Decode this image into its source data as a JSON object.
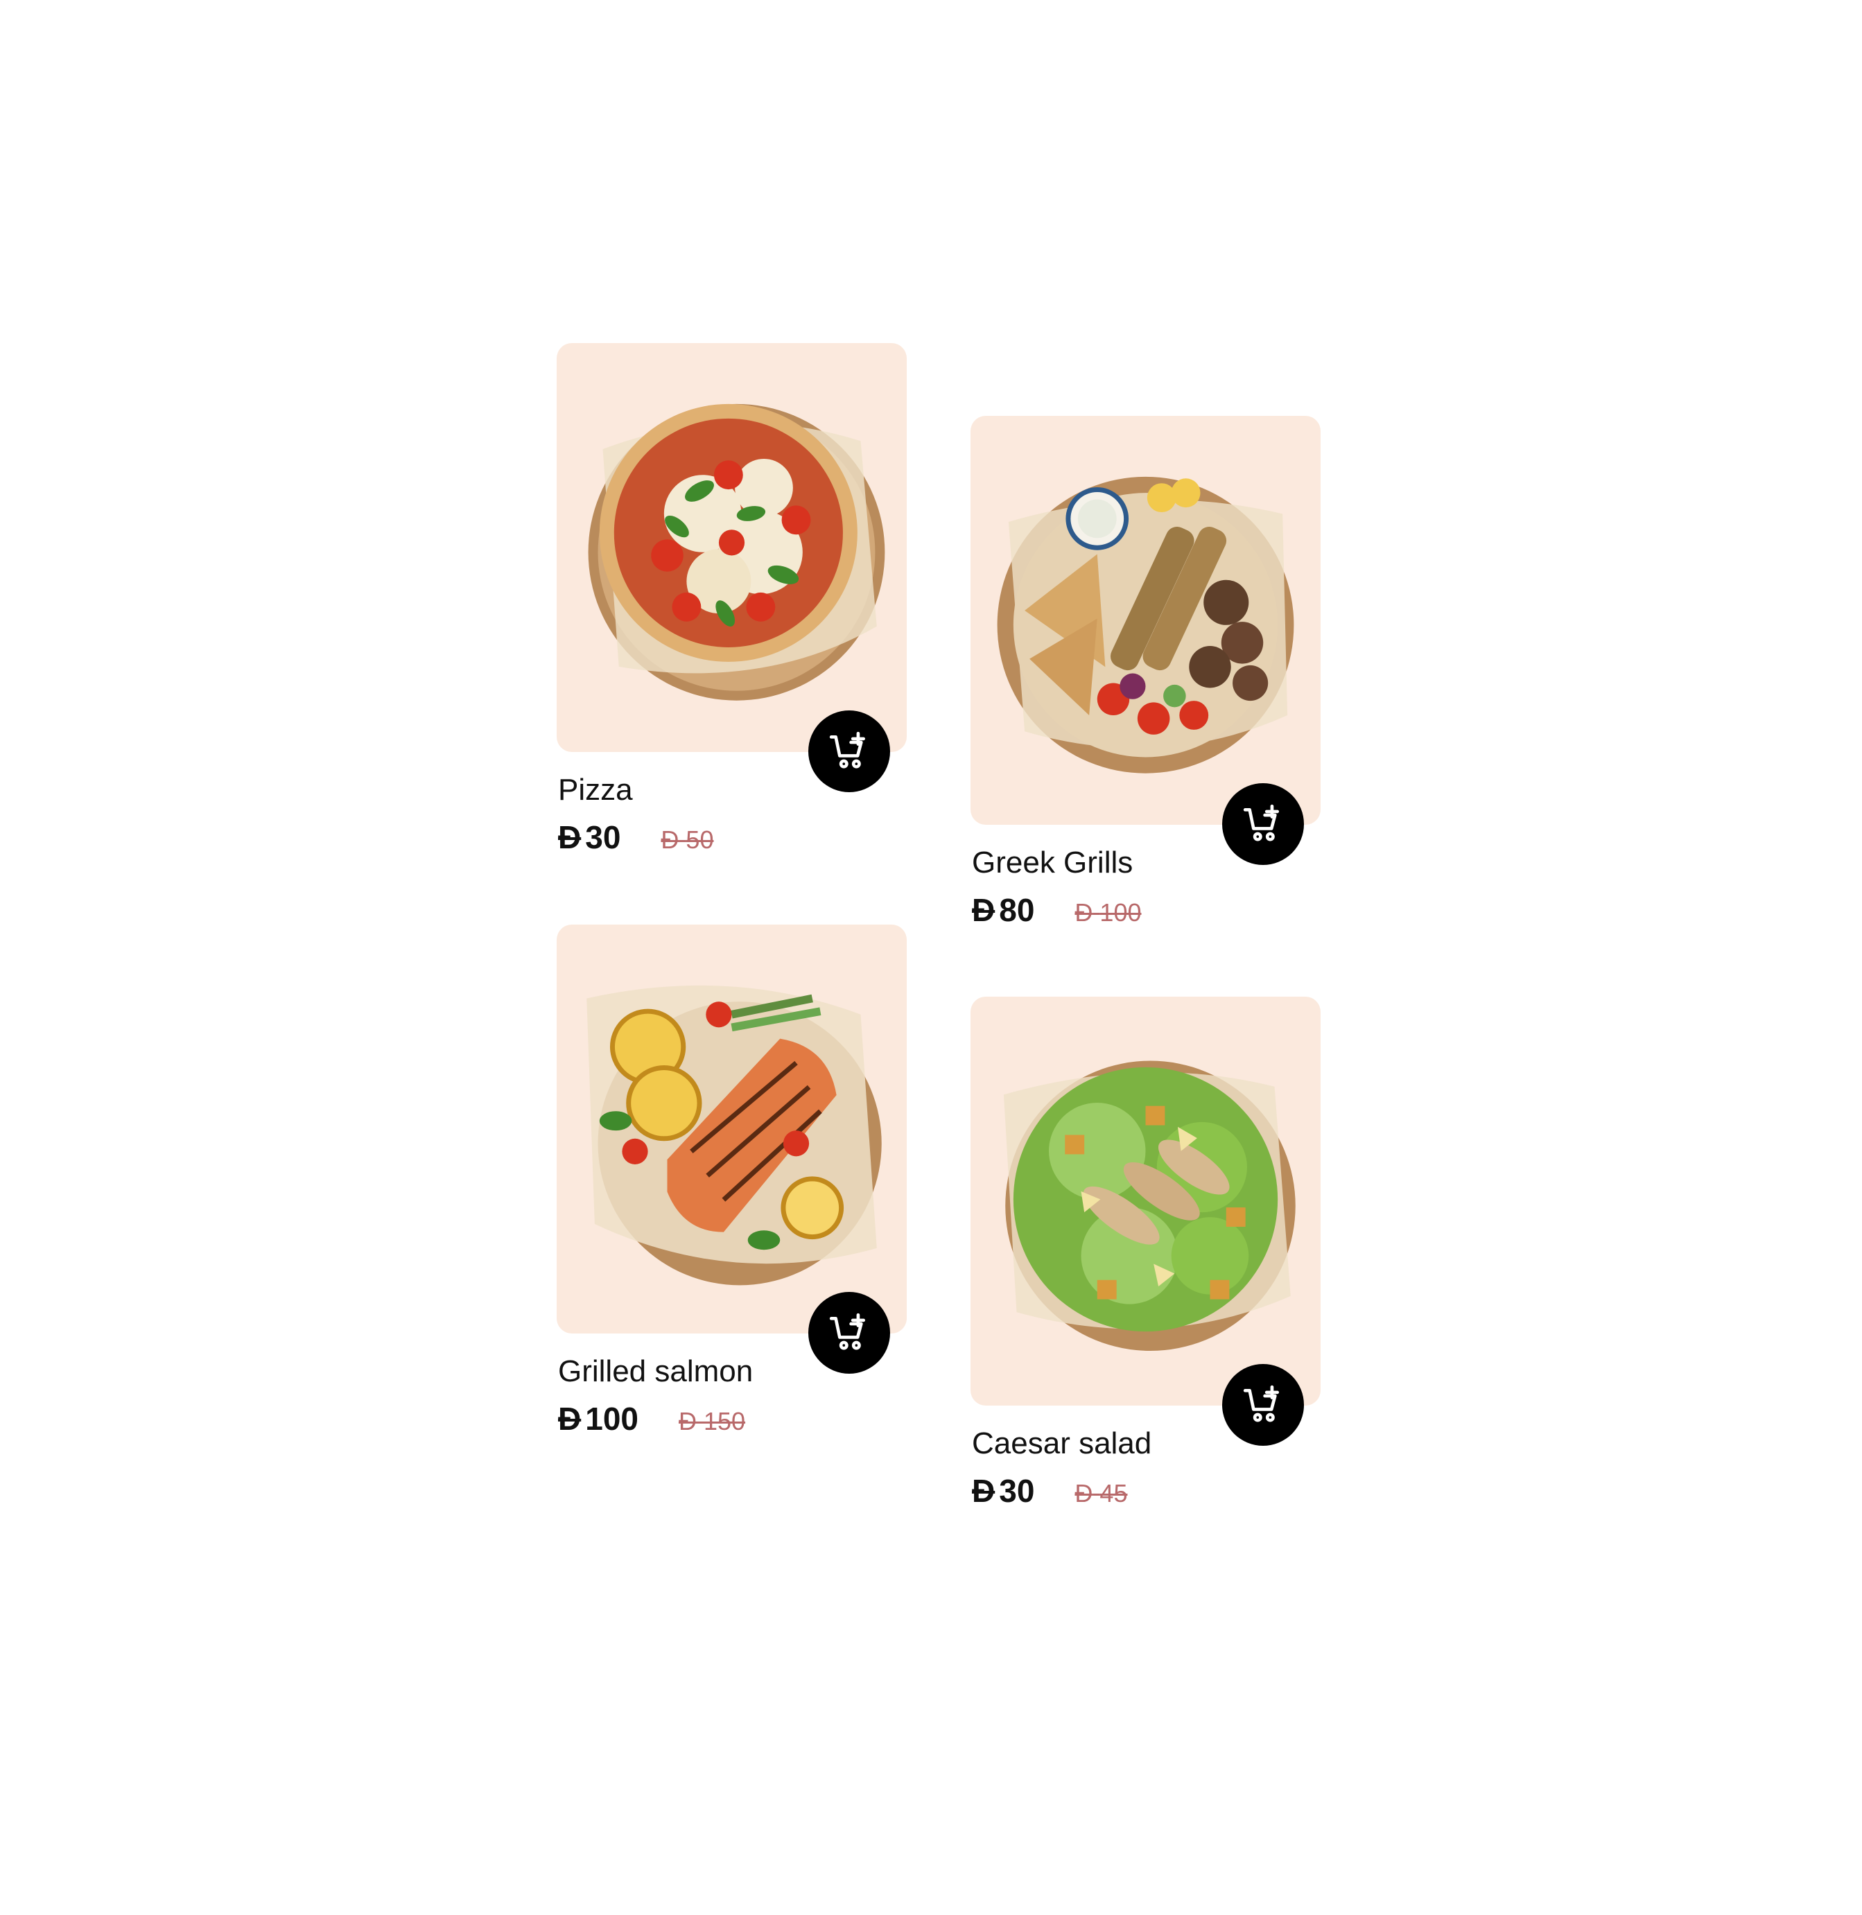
{
  "colors": {
    "card_bg": "#fbe9dd",
    "button_bg": "#000000",
    "old_price": "#b8696a"
  },
  "products": [
    {
      "name": "Pizza",
      "currency": "Đ",
      "price": "30",
      "old_currency": "Đ",
      "old_price": "50",
      "button_icon": "cart-plus-icon",
      "image": "pizza-image"
    },
    {
      "name": "Greek Grills",
      "currency": "Đ",
      "price": "80",
      "old_currency": "Đ",
      "old_price": "100",
      "button_icon": "cart-plus-icon",
      "image": "greek-grill-platter-image"
    },
    {
      "name": "Grilled salmon",
      "currency": "Đ",
      "price": "100",
      "old_currency": "Đ",
      "old_price": "150",
      "button_icon": "cart-plus-icon",
      "image": "grilled-salmon-image"
    },
    {
      "name": "Caesar salad",
      "currency": "Đ",
      "price": "30",
      "old_currency": "Đ",
      "old_price": "45",
      "button_icon": "cart-plus-icon",
      "image": "caesar-salad-image"
    }
  ]
}
